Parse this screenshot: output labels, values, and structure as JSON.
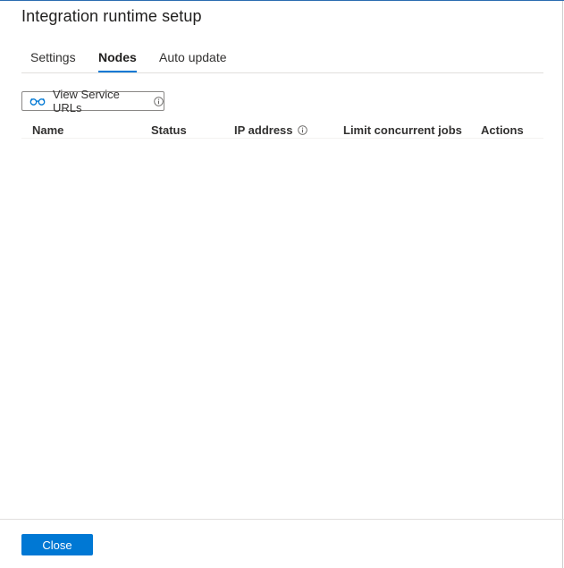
{
  "dialog": {
    "title": "Integration runtime setup"
  },
  "tabs": [
    {
      "label": "Settings",
      "active": false
    },
    {
      "label": "Nodes",
      "active": true
    },
    {
      "label": "Auto update",
      "active": false
    }
  ],
  "toolbar": {
    "view_service_urls_label": "View Service URLs",
    "icon": "glasses-icon"
  },
  "table": {
    "columns": [
      "Name",
      "Status",
      "IP address",
      "Limit concurrent jobs",
      "Actions"
    ],
    "rows": []
  },
  "footer": {
    "close_label": "Close"
  },
  "colors": {
    "accent": "#0078d4",
    "text": "#323130"
  }
}
